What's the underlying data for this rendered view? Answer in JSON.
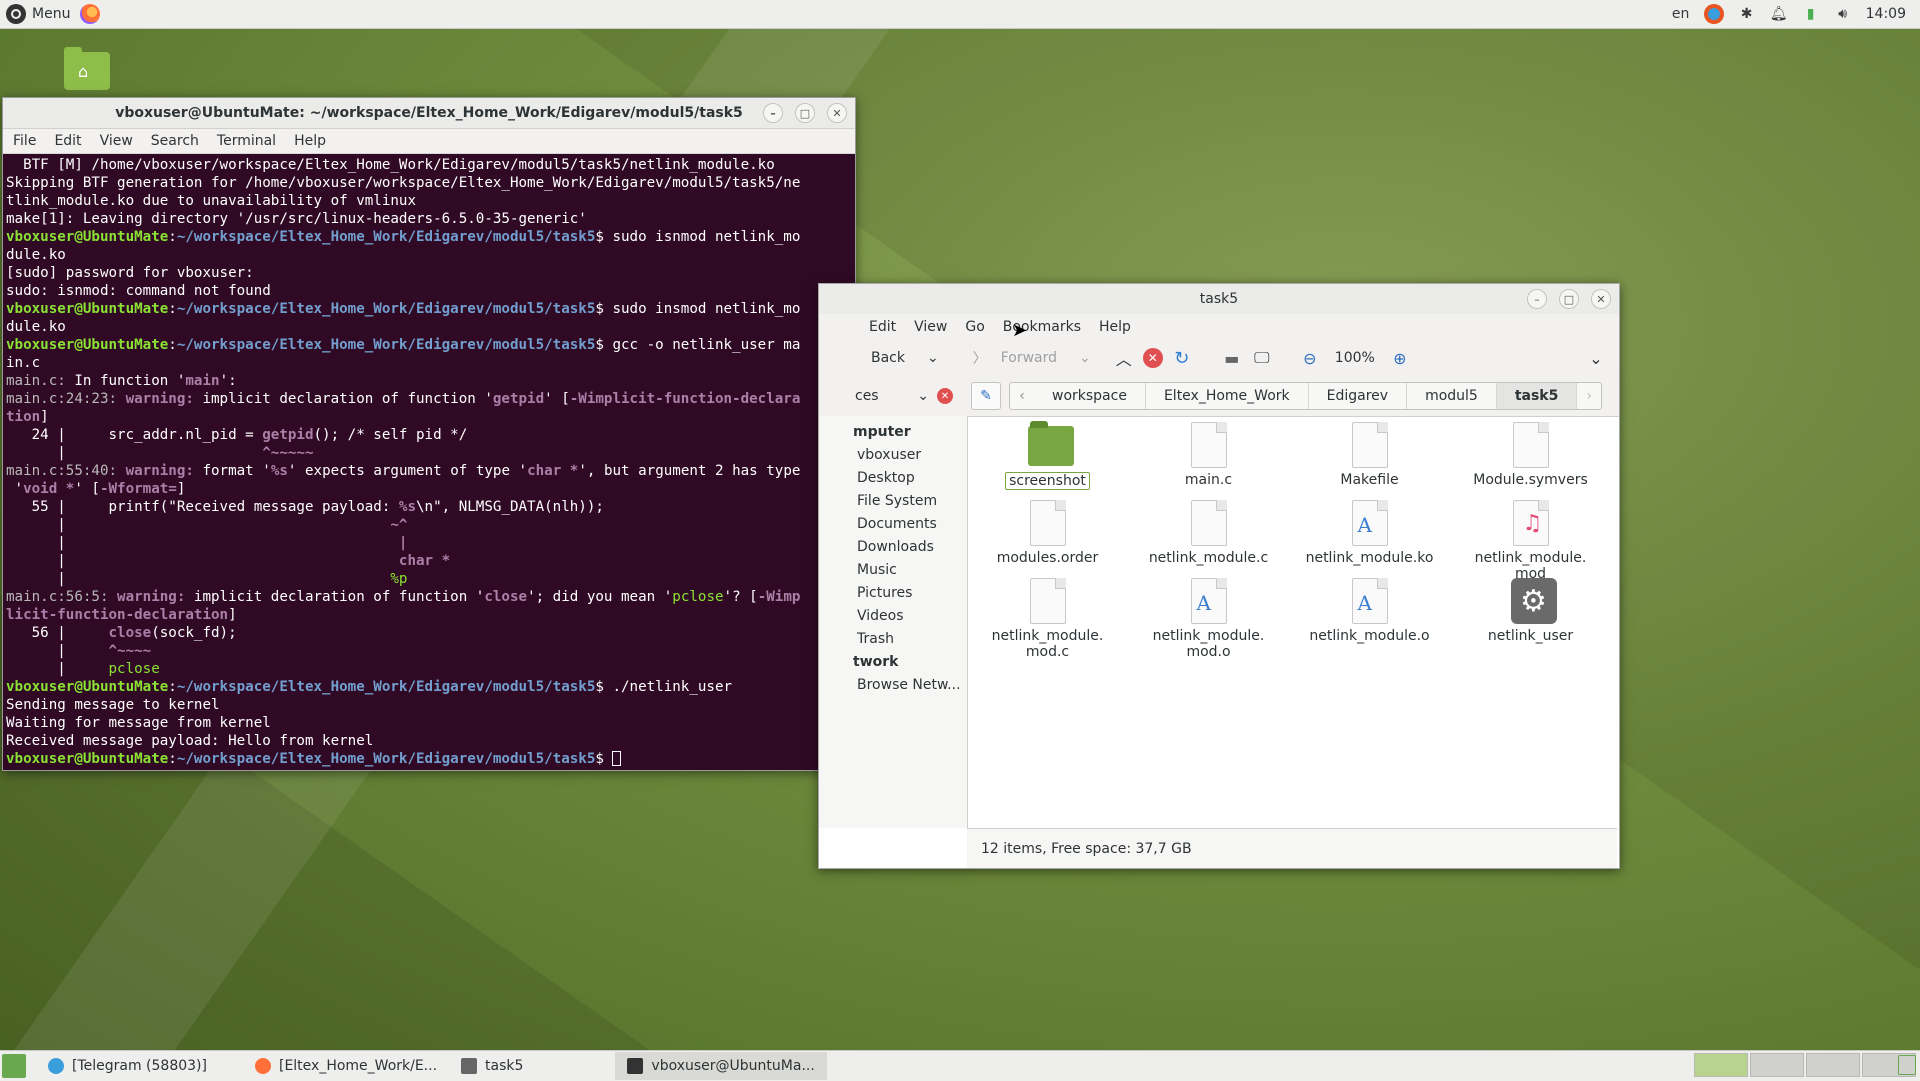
{
  "top_panel": {
    "menu_label": "Menu",
    "lang": "en",
    "clock": "14:09"
  },
  "terminal": {
    "title": "vboxuser@UbuntuMate: ~/workspace/Eltex_Home_Work/Edigarev/modul5/task5",
    "menu": [
      "File",
      "Edit",
      "View",
      "Search",
      "Terminal",
      "Help"
    ],
    "prompt_user": "vboxuser@UbuntuMate",
    "prompt_path": "~/workspace/Eltex_Home_Work/Edigarev/modul5/task5",
    "lines": {
      "l1": "  BTF [M] /home/vboxuser/workspace/Eltex_Home_Work/Edigarev/modul5/task5/netlink_module.ko",
      "l2": "Skipping BTF generation for /home/vboxuser/workspace/Eltex_Home_Work/Edigarev/modul5/task5/ne",
      "l3": "tlink_module.ko due to unavailability of vmlinux",
      "l4": "make[1]: Leaving directory '/usr/src/linux-headers-6.5.0-35-generic'",
      "cmd1a": "$ sudo isnmod netlink_mo",
      "cmd1b": "dule.ko",
      "l5": "[sudo] password for vboxuser:",
      "l6": "sudo: isnmod: command not found",
      "cmd2a": "$ sudo insmod netlink_mo",
      "cmd2b": "dule.ko",
      "cmd3a": "$ gcc -o netlink_user ma",
      "cmd3b": "in.c",
      "w0_loc": "main.c:",
      "w0_txt": " In function '",
      "w0_fn": "main",
      "w0_end": "':",
      "w1_loc": "main.c:24:23:",
      "w1_kw": " warning: ",
      "w1_txt": "implicit declaration of function '",
      "w1_fn": "getpid",
      "w1_end": "' [",
      "w1_flag": "-Wimplicit-function-declara",
      "w1_flag2": "tion",
      "w1_close": "]",
      "src24_no": "   24 |     src_addr.nl_pid = ",
      "src24_fn": "getpid",
      "src24_end": "(); /* self pid */",
      "src24_mark_pre": "      |                       ",
      "src24_mark": "^~~~~~",
      "w2_loc": "main.c:55:40:",
      "w2_kw": " warning: ",
      "w2_txt1": "format '",
      "w2_fmt": "%s",
      "w2_txt2": "' expects argument of type '",
      "w2_type": "char *",
      "w2_txt3": "', but argument 2 has type",
      "w2_txt4": " '",
      "w2_type2": "void *",
      "w2_txt5": "' [",
      "w2_flag": "-Wformat=",
      "w2_close": "]",
      "src55_pre": "   55 |     printf(\"Received message payload: ",
      "src55_fmt": "%s",
      "src55_end": "\\n\", NLMSG_DATA(nlh));",
      "src55_m1_pre": "      |                                      ",
      "src55_m1": "~^",
      "src55_m2_pre": "      |                                       ",
      "src55_m2": "|",
      "src55_m3_pre": "      |                                       ",
      "src55_m3": "char *",
      "src55_m4_pre": "      |                                      ",
      "src55_m4": "%p",
      "w3_loc": "main.c:56:5:",
      "w3_kw": " warning: ",
      "w3_txt1": "implicit declaration of function '",
      "w3_fn": "close",
      "w3_txt2": "'; did you mean '",
      "w3_sugg": "pclose",
      "w3_txt3": "'? [",
      "w3_flag": "-Wimp",
      "w3_flag2": "licit-function-declaration",
      "w3_close": "]",
      "src56_pre": "   56 |     ",
      "src56_fn": "close",
      "src56_end": "(sock_fd);",
      "src56_m1_pre": "      |     ",
      "src56_m1": "^~~~~",
      "src56_m2_pre": "      |     ",
      "src56_m2": "pclose",
      "cmd4": "$ ./netlink_user",
      "o1": "Sending message to kernel",
      "o2": "Waiting for message from kernel",
      "o3": "Received message payload: Hello from kernel",
      "prompt_end": "$ "
    }
  },
  "file_manager": {
    "title": "task5",
    "menu": [
      "Edit",
      "View",
      "Go",
      "Bookmarks",
      "Help"
    ],
    "back_label": "Back",
    "forward_label": "Forward",
    "zoom": "100%",
    "places_label": "ces",
    "breadcrumbs": [
      "workspace",
      "Eltex_Home_Work",
      "Edigarev",
      "modul5",
      "task5"
    ],
    "sidebar": {
      "computer_head": "mputer",
      "items": [
        "vboxuser",
        "Desktop",
        "File System",
        "Documents",
        "Downloads",
        "Music",
        "Pictures",
        "Videos",
        "Trash"
      ],
      "network_head": "twork",
      "network_items": [
        "Browse Netw..."
      ]
    },
    "files": [
      {
        "name": "screenshot",
        "type": "folder"
      },
      {
        "name": "main.c",
        "type": "text"
      },
      {
        "name": "Makefile",
        "type": "text"
      },
      {
        "name": "Module.symvers",
        "type": "text"
      },
      {
        "name": "modules.order",
        "type": "text"
      },
      {
        "name": "netlink_module.c",
        "type": "text"
      },
      {
        "name": "netlink_module.ko",
        "type": "doc"
      },
      {
        "name": "netlink_module.\nmod",
        "type": "audio"
      },
      {
        "name": "netlink_module.\nmod.c",
        "type": "text"
      },
      {
        "name": "netlink_module.\nmod.o",
        "type": "doc"
      },
      {
        "name": "netlink_module.o",
        "type": "doc"
      },
      {
        "name": "netlink_user",
        "type": "exec"
      }
    ],
    "status": "12 items, Free space: 37,7 GB"
  },
  "taskbar": {
    "tasks": [
      "[Telegram (58803)]",
      "[Eltex_Home_Work/E...",
      "task5",
      "vboxuser@UbuntuMa..."
    ]
  },
  "colors": {
    "terminal_bg": "#300a24",
    "prompt_user": "#8ae234",
    "prompt_path": "#729fcf",
    "warning": "#ad7fa8"
  }
}
